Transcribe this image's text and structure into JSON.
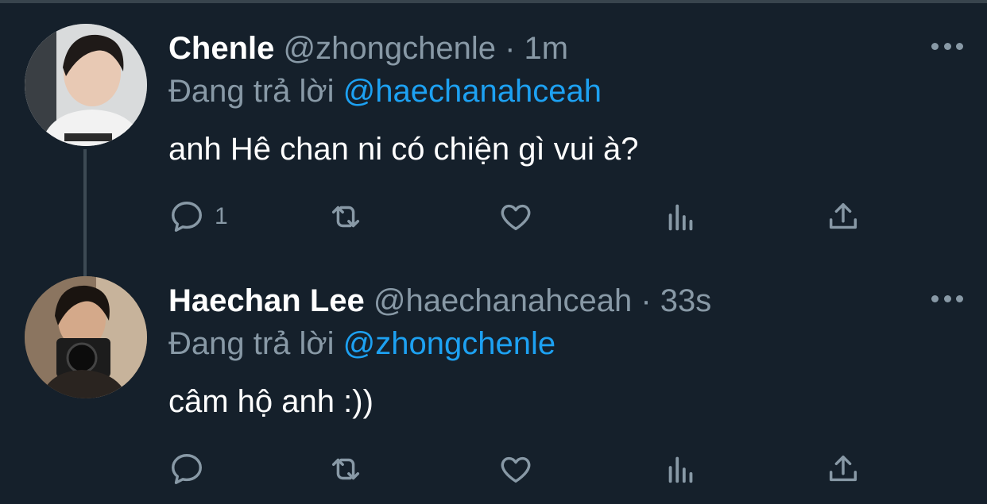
{
  "tweets": [
    {
      "name": "Chenle",
      "handle": "@zhongchenle",
      "separator": "·",
      "time": "1m",
      "replying_label": "Đang trả lời",
      "replying_to": "@haechanahceah",
      "text": "anh Hê chan ni có chiện gì vui à?",
      "reply_count": "1"
    },
    {
      "name": "Haechan Lee",
      "handle": "@haechanahceah",
      "separator": "·",
      "time": "33s",
      "replying_label": "Đang trả lời",
      "replying_to": "@zhongchenle",
      "text": "câm hộ anh :))",
      "reply_count": ""
    }
  ],
  "icons": [
    "reply-icon",
    "retweet-icon",
    "like-icon",
    "analytics-icon",
    "share-icon",
    "more-icon"
  ],
  "colors": {
    "background": "#15202b",
    "link": "#1da1f2",
    "muted": "#8899a6"
  }
}
